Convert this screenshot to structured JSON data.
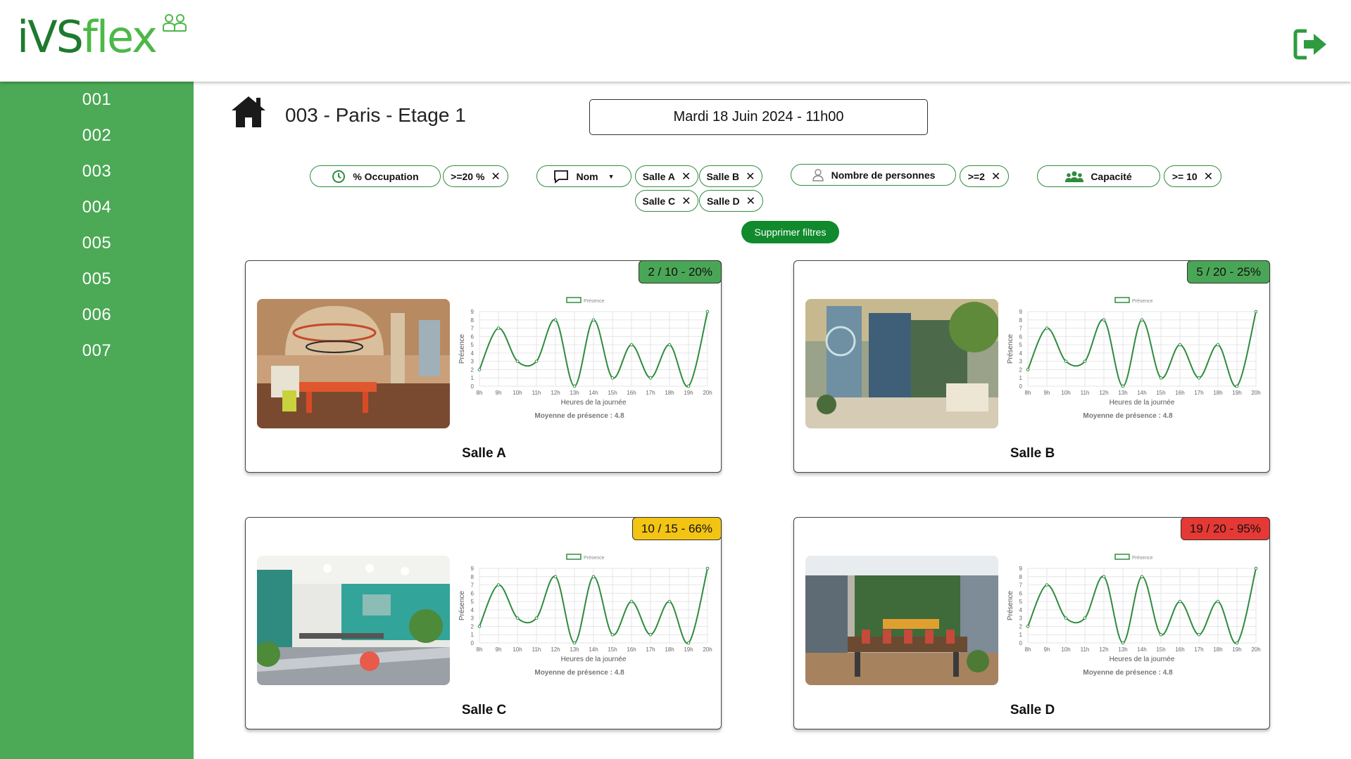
{
  "app": {
    "logo_text_dark": "iVS",
    "logo_text_light": "flex"
  },
  "sidebar": {
    "items": [
      "001",
      "002",
      "003",
      "004",
      "005",
      "005",
      "006",
      "007"
    ]
  },
  "page": {
    "title": "003 - Paris - Etage 1",
    "datetime": "Mardi 18 Juin 2024 - 11h00"
  },
  "filters": {
    "occupation": {
      "label": "% Occupation",
      "value": ">=20 %"
    },
    "nom": {
      "label": "Nom",
      "values": [
        "Salle A",
        "Salle B",
        "Salle C",
        "Salle D"
      ]
    },
    "personnes": {
      "label": "Nombre de personnes",
      "value": ">=2"
    },
    "capacite": {
      "label": "Capacité",
      "value": ">= 10"
    },
    "clear_label": "Supprimer filtres"
  },
  "colors": {
    "green": "#4ca956",
    "badge_green": "#4aa657",
    "badge_yellow": "#f2c414",
    "badge_red": "#e53935",
    "line": "#2e8b3e"
  },
  "rooms": [
    {
      "name": "Salle A",
      "badge": "2 / 10 - 20%",
      "status": "green"
    },
    {
      "name": "Salle B",
      "badge": "5 / 20 - 25%",
      "status": "green"
    },
    {
      "name": "Salle C",
      "badge": "10 / 15 - 66%",
      "status": "yellow"
    },
    {
      "name": "Salle D",
      "badge": "19 / 20 - 95%",
      "status": "red"
    }
  ],
  "chart_data": {
    "type": "line",
    "legend": "Présence",
    "xlabel": "Heures de la journée",
    "ylabel": "Présence",
    "categories": [
      "8h",
      "9h",
      "10h",
      "11h",
      "12h",
      "13h",
      "14h",
      "15h",
      "16h",
      "17h",
      "18h",
      "19h",
      "20h"
    ],
    "series": [
      {
        "name": "Présence",
        "values": [
          2,
          7,
          3,
          3,
          8,
          0,
          8,
          1,
          5,
          1,
          5,
          0,
          9
        ]
      }
    ],
    "ylim": [
      0,
      9
    ],
    "yticks": [
      0,
      1,
      2,
      3,
      4,
      5,
      6,
      7,
      8,
      9
    ],
    "average_label": "Moyenne de présence : 4.8",
    "grid": true
  }
}
